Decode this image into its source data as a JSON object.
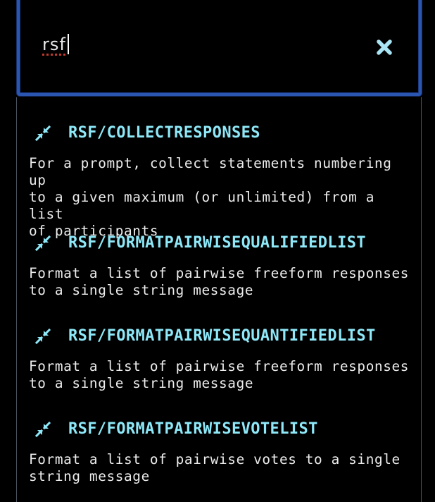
{
  "search": {
    "value": "rsf",
    "clear_icon": "close-icon",
    "spellcheck_error": true
  },
  "colors": {
    "focus_border": "#2a55b0",
    "title": "#8ee8f8",
    "text": "#ececec",
    "background": "#000000",
    "panel_border": "#4a5560"
  },
  "results": [
    {
      "icon": "compress-arrows-icon",
      "title": "RSF/COLLECTRESPONSES",
      "description": "For a prompt, collect statements numbering up\nto a given maximum (or unlimited) from a list\nof participants"
    },
    {
      "icon": "compress-arrows-icon",
      "title": "RSF/FORMATPAIRWISEQUALIFIEDLIST",
      "description": "Format a list of pairwise freeform responses\nto a single string message"
    },
    {
      "icon": "compress-arrows-icon",
      "title": "RSF/FORMATPAIRWISEQUANTIFIEDLIST",
      "description": "Format a list of pairwise freeform responses\nto a single string message"
    },
    {
      "icon": "compress-arrows-icon",
      "title": "RSF/FORMATPAIRWISEVOTELIST",
      "description": "Format a list of pairwise votes to a single\nstring message"
    }
  ]
}
